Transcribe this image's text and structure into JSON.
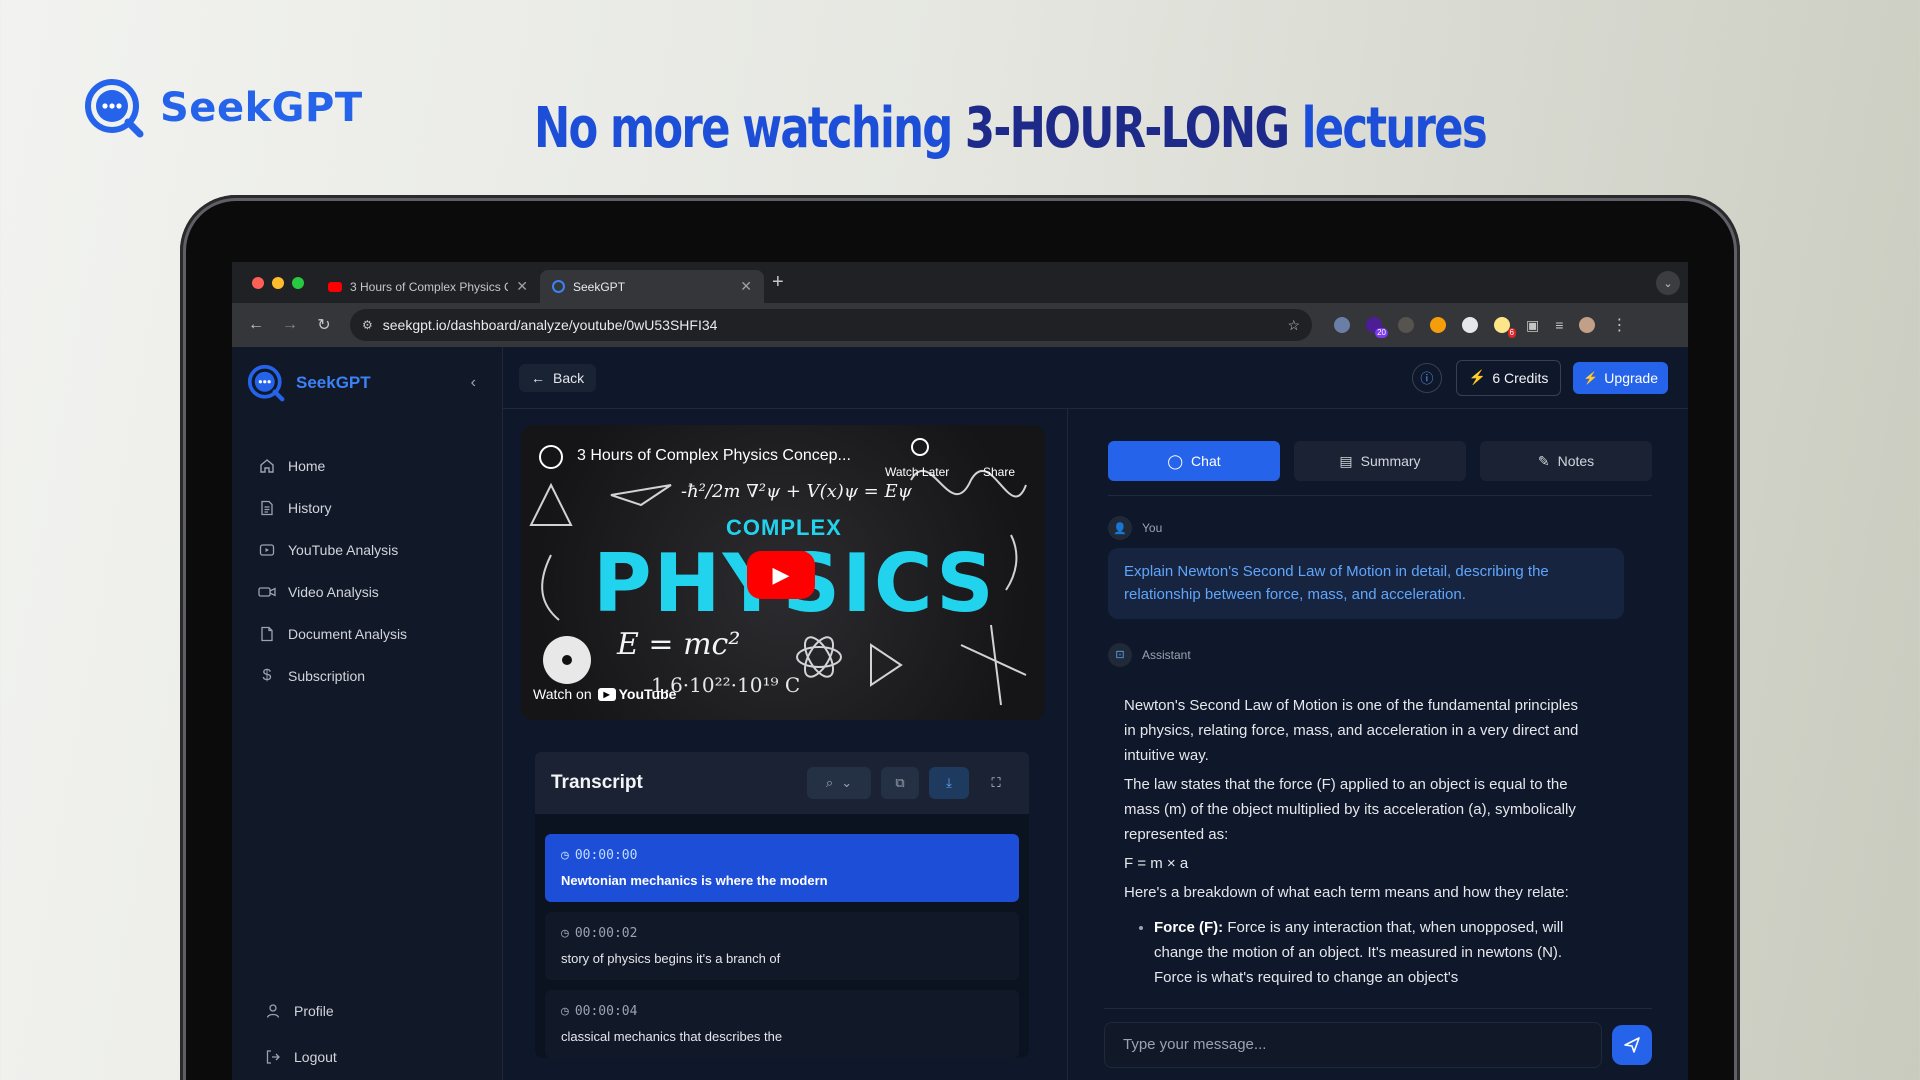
{
  "hero": {
    "brand": "SeekGPT",
    "headline_a": "No more watching ",
    "headline_b": "3-HOUR-LONG",
    "headline_c": " lectures"
  },
  "browser": {
    "tabs": [
      {
        "label": "3 Hours of Complex Physics C",
        "icon": "youtube-icon"
      },
      {
        "label": "SeekGPT",
        "icon": "seekgpt-icon"
      }
    ],
    "url": "seekgpt.io/dashboard/analyze/youtube/0wU53SHFI34",
    "extension_badges": [
      "20",
      "6"
    ]
  },
  "sidebar": {
    "title": "SeekGPT",
    "items": [
      {
        "label": "Home",
        "icon": "home-icon"
      },
      {
        "label": "History",
        "icon": "history-icon"
      },
      {
        "label": "YouTube Analysis",
        "icon": "youtube-icon"
      },
      {
        "label": "Video Analysis",
        "icon": "video-icon"
      },
      {
        "label": "Document Analysis",
        "icon": "document-icon"
      },
      {
        "label": "Subscription",
        "icon": "dollar-icon"
      }
    ],
    "bottom": [
      {
        "label": "Profile",
        "icon": "user-icon"
      },
      {
        "label": "Logout",
        "icon": "logout-icon"
      }
    ]
  },
  "topbar": {
    "back": "Back",
    "credits": "6 Credits",
    "upgrade": "Upgrade"
  },
  "video": {
    "title": "3 Hours of Complex Physics Concep...",
    "headline_small": "COMPLEX",
    "headline_big": "PHYSICS",
    "watch_later": "Watch Later",
    "share": "Share",
    "watch_on": "Watch on",
    "platform": "YouTube",
    "formula_a": "-ħ²/2m ∇²ψ + V(x)ψ = Eψ",
    "formula_b": "E = mc²",
    "formula_c": "1.6·10²²·10¹⁹ C"
  },
  "transcript": {
    "title": "Transcript",
    "segments": [
      {
        "time": "00:00:00",
        "text": "Newtonian mechanics is where the modern",
        "active": true
      },
      {
        "time": "00:00:02",
        "text": "story of physics begins it's a branch of",
        "active": false
      },
      {
        "time": "00:00:04",
        "text": "classical mechanics that describes the",
        "active": false
      }
    ]
  },
  "chat": {
    "tabs": [
      "Chat",
      "Summary",
      "Notes"
    ],
    "user_label": "You",
    "user_message": "Explain Newton's Second Law of Motion in detail, describing the relationship between force, mass, and acceleration.",
    "assistant_label": "Assistant",
    "assistant_p1": "Newton's Second Law of Motion is one of the fundamental principles in physics, relating force, mass, and acceleration in a very direct and intuitive way.",
    "assistant_p2": "The law states that the force (F) applied to an object is equal to the mass (m) of the object multiplied by its acceleration (a), symbolically represented as:",
    "assistant_formula": "F = m × a",
    "assistant_p3": "Here's a breakdown of what each term means and how they relate:",
    "bullet_term": "Force (F):",
    "bullet_text": " Force is any interaction that, when unopposed, will change the motion of an object. It's measured in newtons (N). Force is what's required to change an object's",
    "input_placeholder": "Type your message..."
  },
  "colors": {
    "accent": "#2563eb",
    "sidebar_bg": "#111827",
    "app_bg": "#0f172a",
    "user_text": "#60a5fa"
  }
}
